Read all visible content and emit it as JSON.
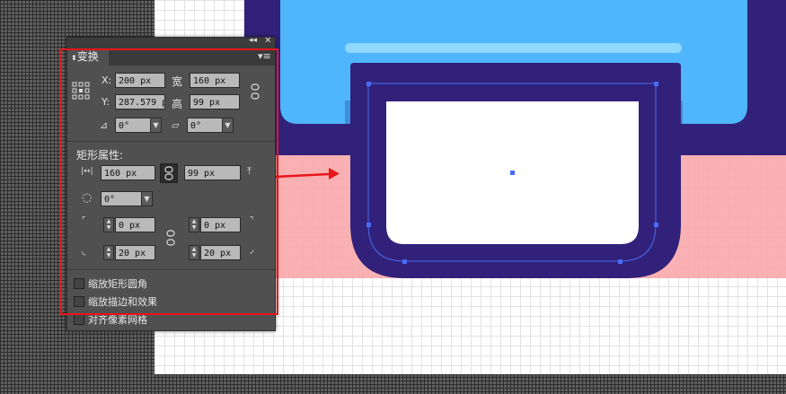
{
  "panel": {
    "collapse_icon": "double-chevron-left-icon",
    "close_icon": "close-icon",
    "tab_label": "变换",
    "menu_icon": "panel-menu-icon",
    "x_label": "X:",
    "x_value": "200 px",
    "y_label": "Y:",
    "y_value": "287.579 p",
    "w_label": "宽",
    "w_value": "160 px",
    "h_label": "高",
    "h_value": "99 px",
    "rotate_value": "0°",
    "shear_value": "0°",
    "rect_section_title": "矩形属性:",
    "rect_width": "160 px",
    "rect_height": "99 px",
    "rect_rotate": "0°",
    "corner_tl": "0 px",
    "corner_tr": "0 px",
    "corner_bl": "20 px",
    "corner_br": "20 px",
    "checkboxes": [
      {
        "label": "缩放矩形圆角"
      },
      {
        "label": "缩放描边和效果"
      },
      {
        "label": "对齐像素网格"
      }
    ]
  },
  "colors": {
    "highlight_red": "#e8151b",
    "navy": "#31217a",
    "sky_blue": "#4fb6fb",
    "pink": "#f9a8ab",
    "selection_blue": "#4a6cf4"
  }
}
